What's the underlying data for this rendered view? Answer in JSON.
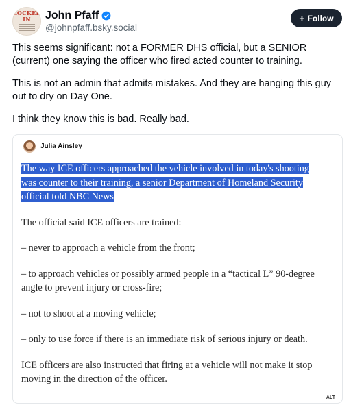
{
  "author": {
    "display_name": "John Pfaff",
    "handle": "@johnpfaff.bsky.social",
    "avatar_text": "LOCKED IN"
  },
  "follow_button": {
    "label": "Follow"
  },
  "post": {
    "paragraphs": [
      "This seems significant: not a FORMER DHS official, but a SENIOR (current) one saying the officer who fired acted counter to training.",
      "This is not an admin that admits mistakes. And they are hanging this guy out to dry on Day One.",
      "I think they know this is bad. Really bad."
    ]
  },
  "embed": {
    "author_name": "Julia Ainsley",
    "highlighted_text": "The way ICE officers approached the vehicle involved in today's shooting was counter to their training, a senior Department of Homeland Security official told NBC News",
    "paragraphs": [
      "The official said ICE officers are trained:",
      "– never to approach a vehicle from the front;",
      "– to approach vehicles or possibly armed people in a “tactical L” 90-degree angle to prevent injury or cross-fire;",
      "– not to shoot at a moving vehicle;",
      "– only to use force if there is an immediate risk of serious injury or death.",
      "ICE officers are also instructed that firing at a vehicle will not make it stop moving in the direction of the officer."
    ],
    "alt_badge": "ALT"
  },
  "colors": {
    "follow_bg": "#1b2430",
    "highlight": "#2f5fd0",
    "verified": "#1185fe"
  }
}
